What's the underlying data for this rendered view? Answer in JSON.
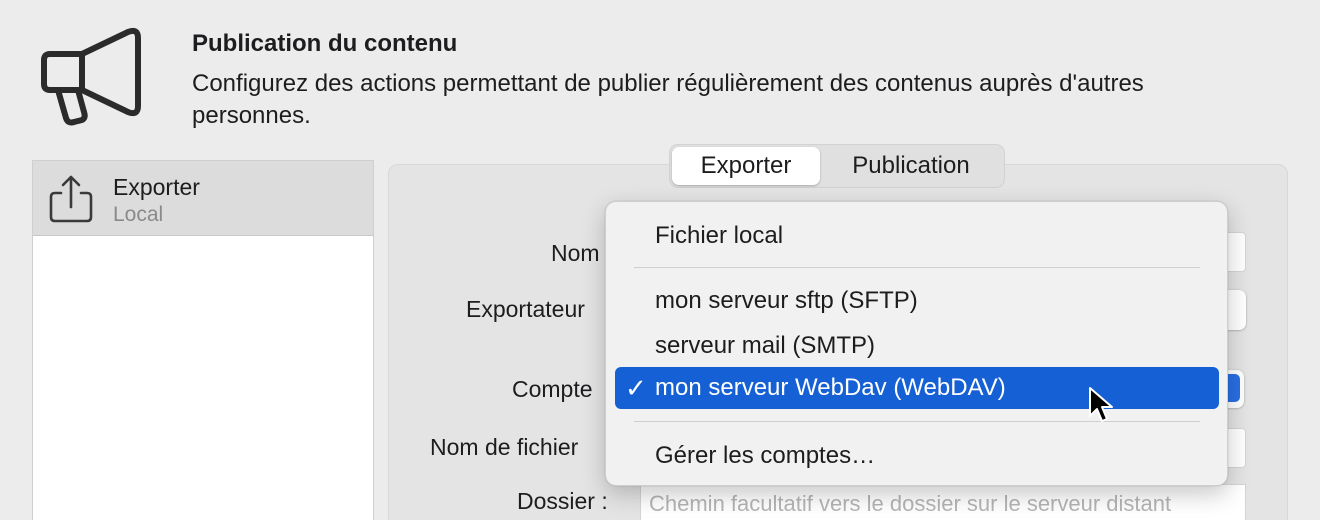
{
  "header": {
    "title": "Publication du contenu",
    "description": "Configurez des actions permettant de publier régulièrement des contenus auprès d'autres personnes.",
    "icon": "megaphone-icon"
  },
  "sidebar": {
    "items": [
      {
        "title": "Exporter",
        "subtitle": "Local",
        "icon": "share-export-icon"
      }
    ]
  },
  "tabs": {
    "items": [
      {
        "label": "Exporter",
        "active": true
      },
      {
        "label": "Publication",
        "active": false
      }
    ]
  },
  "form": {
    "name_label": "Nom",
    "exporter_label": "Exportateur",
    "account_label": "Compte",
    "filename_label": "Nom de fichier",
    "folder_label": "Dossier :",
    "folder_placeholder": "Chemin facultatif vers le dossier sur le serveur distant"
  },
  "menu": {
    "items": [
      {
        "label": "Fichier local",
        "selected": false
      },
      {
        "label": "mon serveur sftp (SFTP)",
        "selected": false
      },
      {
        "label": "serveur mail (SMTP)",
        "selected": false
      },
      {
        "label": "mon serveur WebDav (WebDAV)",
        "selected": true
      },
      {
        "label": "Gérer les comptes…",
        "selected": false
      }
    ],
    "check_glyph": "✓"
  },
  "colors": {
    "accent": "#1660d6",
    "background": "#ececec"
  }
}
